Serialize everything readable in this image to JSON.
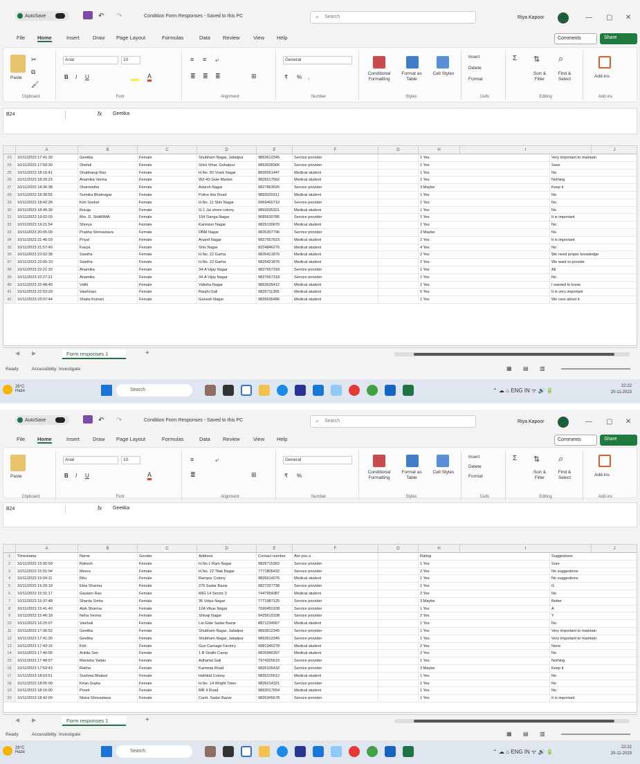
{
  "window": {
    "autosave_label": "AutoSave",
    "file_title": "Condition Form Responses - Saved to this PC",
    "search_placeholder": "Search",
    "user_name": "Riya Kapoor",
    "user_name_2": "Riya Kapoor",
    "minimize": "—",
    "maximize": "▢",
    "close": "✕"
  },
  "menu": {
    "items": [
      "File",
      "Home",
      "Insert",
      "Draw",
      "Page Layout",
      "Formulas",
      "Data",
      "Review",
      "View",
      "Help"
    ],
    "comments_label": "Comments",
    "share_label": "Share"
  },
  "ribbon": {
    "paste": "Paste",
    "clipboard": "Clipboard",
    "font_name": "Arial",
    "font_size": "10",
    "font": "Font",
    "alignment": "Alignment",
    "number_format": "General",
    "number": "Number",
    "cond_format": "Conditional Formatting",
    "format_table": "Format as Table",
    "cell_styles": "Cell Styles",
    "styles": "Styles",
    "insert": "Insert",
    "delete": "Delete",
    "format": "Format",
    "cells": "Cells",
    "sort_filter": "Sort & Filter",
    "find_select": "Find & Select",
    "editing": "Editing",
    "addins": "Add-ins",
    "addins_group": "Add-ins"
  },
  "formula_bar": {
    "name_box": "B24",
    "fx": "fx",
    "value_1": "Geetika",
    "value_2": "Geetika"
  },
  "grid": {
    "columns": [
      "A",
      "B",
      "C",
      "D",
      "E",
      "F",
      "G",
      "H",
      "I",
      "J",
      "K"
    ],
    "header_row": [
      "Timestamp",
      "Name",
      "Gender",
      "Address",
      "Contact number",
      "Are you a",
      "",
      "Rating",
      "Suggestions"
    ],
    "rows_1": [
      {
        "n": "23",
        "cells": [
          "10/11/2023 17:41:30",
          "Geetika",
          "Female",
          "Shubham Nagar, Jabalpur",
          "9893612345",
          "Service provider",
          "",
          "1 Yes",
          "Very important to maintain"
        ]
      },
      {
        "n": "24",
        "cells": [
          "10/11/2023 17:50:30",
          "Shefali",
          "Female",
          "Shivi Vihar, Gohalpur",
          "9893028306",
          "Service provider",
          "",
          "1 Yes",
          "Save"
        ]
      },
      {
        "n": "25",
        "cells": [
          "10/11/2023 18:16:41",
          "Shubhangi Rao",
          "Female",
          "H.No. 50 Vivek Nagar",
          "8839561447",
          "Medical student",
          "",
          "1 Yes",
          "No"
        ]
      },
      {
        "n": "26",
        "cells": [
          "10/11/2023 18:20:23",
          "Anamika Verma",
          "Female",
          "WZ-43 Gole Market",
          "9826517562",
          "Medical student",
          "",
          "1 Yes",
          "Nothing"
        ]
      },
      {
        "n": "27",
        "cells": [
          "10/11/2023 18:36:38",
          "Sharmistha",
          "Female",
          "Adarsh Nagar",
          "9827863026",
          "Service provider",
          "",
          "3 Maybe",
          "Keep it"
        ]
      },
      {
        "n": "28",
        "cells": [
          "10/11/2023 18:38:55",
          "Sumitra Bhatnagar",
          "Female",
          "Police line Road",
          "9893029311",
          "Medical student",
          "",
          "1 Yes",
          "No"
        ]
      },
      {
        "n": "29",
        "cells": [
          "10/11/2023 18:42:28",
          "Kirti Sonker",
          "Female",
          "H.No. 11 Shiv Nagar",
          "9969460710",
          "Service provider",
          "",
          "1 Yes",
          "No"
        ]
      },
      {
        "n": "30",
        "cells": [
          "10/11/2023 18:45:39",
          "Rutuja",
          "Female",
          "G-1 Jai shree colony",
          "9893035321",
          "Medical student",
          "",
          "1 Yes",
          "No"
        ]
      },
      {
        "n": "31",
        "cells": [
          "10/11/2023 19:02:03",
          "Mrs. D. SHARMA",
          "Female",
          "154 Ganga Nagar",
          "9685630785",
          "Service provider",
          "",
          "1 Yes",
          "It is important"
        ]
      },
      {
        "n": "32",
        "cells": [
          "10/11/2023 19:21:54",
          "Shreya",
          "Female",
          "Karmavir Nagar",
          "9826130670",
          "Medical student",
          "",
          "1 Yes",
          "No"
        ]
      },
      {
        "n": "33",
        "cells": [
          "10/11/2023 20:05:09",
          "Prabha Shrivastava",
          "Female",
          "DBM Nagar",
          "9826307796",
          "Service provider",
          "",
          "3 Maybe",
          "No"
        ]
      },
      {
        "n": "34",
        "cells": [
          "10/11/2023 21:46:03",
          "Priyal",
          "Female",
          "Anand Nagar",
          "9827557615",
          "Medical student",
          "",
          "2 Yes",
          "It is important"
        ]
      },
      {
        "n": "35",
        "cells": [
          "10/11/2023 21:57:40",
          "Kavya",
          "Female",
          "Shiv Nagar",
          "8224846276",
          "Medical student",
          "",
          "4 Yes",
          "No"
        ]
      },
      {
        "n": "36",
        "cells": [
          "10/11/2023 22:02:38",
          "Swetha",
          "Female",
          "H.No. 22 Garha",
          "9826421876",
          "Medical student",
          "",
          "2 Yes",
          "We need proper knowledge"
        ]
      },
      {
        "n": "37",
        "cells": [
          "10/11/2023 22:05:10",
          "Swetha",
          "Female",
          "H.No. 22 Garha",
          "9826421876",
          "Medical student",
          "",
          "2 Yes",
          "We want to provide"
        ]
      },
      {
        "n": "38",
        "cells": [
          "10/11/2023 22:21:33",
          "Anamika",
          "Female",
          "34-A Vijay Nagar",
          "9827657318",
          "Service provider",
          "",
          "1 Yes",
          "All"
        ]
      },
      {
        "n": "39",
        "cells": [
          "10/11/2023 22:27:21",
          "Anamika",
          "Female",
          "34-A Vijay Nagar",
          "9827657318",
          "Service provider",
          "",
          "1 Yes",
          "No"
        ]
      },
      {
        "n": "40",
        "cells": [
          "10/11/2023 22:48:40",
          "Vidhi",
          "Female",
          "Vidisha Nagar",
          "9893635412",
          "Medical student",
          "",
          "1 Yes",
          "I wanted to know"
        ]
      },
      {
        "n": "41",
        "cells": [
          "10/11/2023 22:53:29",
          "Vaishnavi",
          "Female",
          "Ranjhi Gali",
          "9826711365",
          "Medical student",
          "",
          "5 Yes",
          "It is very important"
        ]
      },
      {
        "n": "42",
        "cells": [
          "10/11/2023 23:07:44",
          "Shaila Kumari",
          "Female",
          "Ganesh Nagar",
          "9826635486",
          "Medical student",
          "",
          "1 Yes",
          "We care about it"
        ]
      }
    ],
    "rows_2": [
      {
        "n": "1",
        "cells": [
          "Timestamp",
          "Name",
          "Gender",
          "Address",
          "Contact number",
          "Are you a",
          "",
          "Rating",
          "Suggestions"
        ]
      },
      {
        "n": "2",
        "cells": [
          "10/11/2023 15:00:59",
          "Rakesh",
          "Female",
          "H.No.1 Ram Nagar",
          "9826715362",
          "Service provider",
          "",
          "1 Yes",
          "Sure"
        ]
      },
      {
        "n": "3",
        "cells": [
          "10/11/2023 15:01:04",
          "Meera",
          "Female",
          "H.No. 22 Tilak Nagar",
          "7771806432",
          "Service provider",
          "",
          "2 Yes",
          "No suggestions"
        ]
      },
      {
        "n": "4",
        "cells": [
          "10/11/2023 15:04:11",
          "Ritu",
          "Female",
          "Rampur Colony",
          "9826514076",
          "Medical student",
          "",
          "1 Yes",
          "No suggestions"
        ]
      },
      {
        "n": "5",
        "cells": [
          "10/11/2023 15:29:19",
          "Ekta Sharma",
          "Female",
          "276 Sadar Bazar",
          "9827327738",
          "Service provider",
          "",
          "1 Yes",
          "G"
        ]
      },
      {
        "n": "6",
        "cells": [
          "10/11/2023 15:31:17",
          "Gautam Rao",
          "Female",
          "MIG 14 Sector 3",
          "7447654987",
          "Medical student",
          "",
          "2 Yes",
          "No"
        ]
      },
      {
        "n": "7",
        "cells": [
          "10/11/2023 15:37:48",
          "Sharda Sinha",
          "Female",
          "36 Vidya Nagar",
          "7771987125",
          "Service provider",
          "",
          "3 Maybe",
          "Better"
        ]
      },
      {
        "n": "8",
        "cells": [
          "10/11/2023 15:41:40",
          "Alok Sharma",
          "Female",
          "12A Vikas Nagar",
          "7690450108",
          "Service provider",
          "",
          "1 Yes",
          "A"
        ]
      },
      {
        "n": "9",
        "cells": [
          "10/11/2023 15:46:18",
          "Neha Verma",
          "Female",
          "Shivaji Nagar",
          "9425619108",
          "Service provider",
          "",
          "2 Yes",
          "Y"
        ]
      },
      {
        "n": "10",
        "cells": [
          "10/11/2023 16:25:07",
          "Vaishali",
          "Female",
          "Lal Gate Sadar Bazar",
          "8871234567",
          "Medical student",
          "",
          "1 Yes",
          "No"
        ]
      },
      {
        "n": "11",
        "cells": [
          "10/11/2023 17:36:52",
          "Geetika",
          "Female",
          "Shubham Nagar, Jabalpur",
          "9893612345",
          "Service provider",
          "",
          "1 Yes",
          "Very important to maintain"
        ]
      },
      {
        "n": "12",
        "cells": [
          "10/11/2023 17:41:30",
          "Geetika",
          "Female",
          "Shubham Nagar, Jabalpur",
          "9893612345",
          "Service provider",
          "",
          "1 Yes",
          "Very important to maintain"
        ]
      },
      {
        "n": "13",
        "cells": [
          "10/11/2023 17:43:16",
          "Kirti",
          "Female",
          "Gun Carriage Factory",
          "9981346278",
          "Medical student",
          "",
          "2 Yes",
          "None"
        ]
      },
      {
        "n": "14",
        "cells": [
          "10/11/2023 17:46:05",
          "Ankita Sen",
          "Female",
          "1 B Sindhi Camp",
          "9826946397",
          "Medical student",
          "",
          "2 Yes",
          "No"
        ]
      },
      {
        "n": "15",
        "cells": [
          "10/11/2023 17:48:07",
          "Manisha Yadav",
          "Female",
          "Adhartal Gali",
          "7974325615",
          "Service provider",
          "",
          "1 Yes",
          "Nothing"
        ]
      },
      {
        "n": "16",
        "cells": [
          "10/11/2023 17:53:43",
          "Rekha",
          "Female",
          "Karmeta Road",
          "9826105432",
          "Service provider",
          "",
          "3 Maybe",
          "Keep it"
        ]
      },
      {
        "n": "17",
        "cells": [
          "10/11/2023 18:03:51",
          "Sushma Bhalavi",
          "Female",
          "Hathital Colony",
          "9826315612",
          "Medical student",
          "",
          "1 Yes",
          "No"
        ]
      },
      {
        "n": "18",
        "cells": [
          "10/11/2023 18:05:09",
          "Kiran Gupta",
          "Female",
          "H.No. 14 Wright Town",
          "9826014321",
          "Service provider",
          "",
          "1 Yes",
          "No"
        ]
      },
      {
        "n": "19",
        "cells": [
          "10/11/2023 18:16:00",
          "Preeti",
          "Female",
          "MR 4 Road",
          "9893017654",
          "Medical student",
          "",
          "1 Yes",
          "No"
        ]
      },
      {
        "n": "20",
        "cells": [
          "10/11/2023 18:42:09",
          "Nisha Shrivastava",
          "Female",
          "Cantt. Sadar Bazar",
          "9826345678",
          "Service provider",
          "",
          "1 Yes",
          "It is important"
        ]
      }
    ]
  },
  "sheet": {
    "tab_name": "Form responses 1",
    "add": "+",
    "status": "Ready",
    "accessibility": "Accessibility: Investigate"
  },
  "taskbar": {
    "weather_temp": "26°C",
    "weather_desc": "Haze",
    "search": "Search",
    "lang": "ENG IN",
    "time_1": "22:22",
    "date_1": "20-11-2023",
    "time_2": "22:22",
    "date_2": "20-11-2023"
  }
}
